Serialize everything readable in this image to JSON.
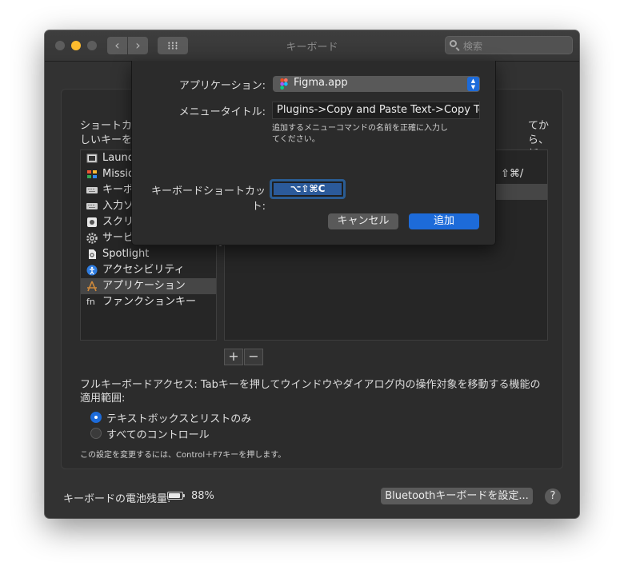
{
  "window": {
    "title": "キーボード",
    "search_placeholder": "検索",
    "nav_back": "‹",
    "nav_forward": "›"
  },
  "panel": {
    "description_line1": "ショートカ",
    "description_line2": "しいキーを押",
    "description_right": "てから、新",
    "categories": [
      {
        "label": "Launchpad",
        "icon": "launchpad-icon"
      },
      {
        "label": "Mission Control",
        "icon": "mission-control-icon"
      },
      {
        "label": "キーボード",
        "icon": "keyboard-icon"
      },
      {
        "label": "入力ソース",
        "icon": "input-source-icon"
      },
      {
        "label": "スクリーンショット",
        "icon": "screenshot-icon"
      },
      {
        "label": "サービス",
        "icon": "services-gear-icon"
      },
      {
        "label": "Spotlight",
        "icon": "spotlight-icon"
      },
      {
        "label": "アクセシビリティ",
        "icon": "accessibility-icon"
      },
      {
        "label": "アプリケーション",
        "icon": "app-store-icon",
        "selected": true
      },
      {
        "label": "ファンクションキー",
        "icon": "function-key-icon"
      }
    ],
    "right_shortcut_text": "⇧⌘/",
    "plus": "+",
    "minus": "−",
    "full_keyboard_access": "フルキーボードアクセス: Tabキーを押してウインドウやダイアログ内の操作対象を移動する機能の適用範囲:",
    "radio_text_and_lists": "テキストボックスとリストのみ",
    "radio_all_controls": "すべてのコントロール",
    "note": "この設定を変更するには、Control＋F7キーを押します。"
  },
  "footer": {
    "battery_label": "キーボードの電池残量:",
    "battery_percent": "88%",
    "battery_level": 0.88,
    "bluetooth_button": "Bluetoothキーボードを設定...",
    "help": "?"
  },
  "sheet": {
    "application_label": "アプリケーション:",
    "application_value": "Figma.app",
    "menu_title_label": "メニュータイトル:",
    "menu_title_value": "Plugins->Copy and Paste Text->Copy Text",
    "hint": "追加するメニューコマンドの名前を正確に入力してください。",
    "shortcut_label": "キーボードショートカット:",
    "shortcut_value": "⌥⇧⌘C",
    "cancel": "キャンセル",
    "add": "追加"
  },
  "colors": {
    "accent": "#1d6bd9",
    "window_bg": "#323232",
    "minimize": "#febc2e"
  }
}
